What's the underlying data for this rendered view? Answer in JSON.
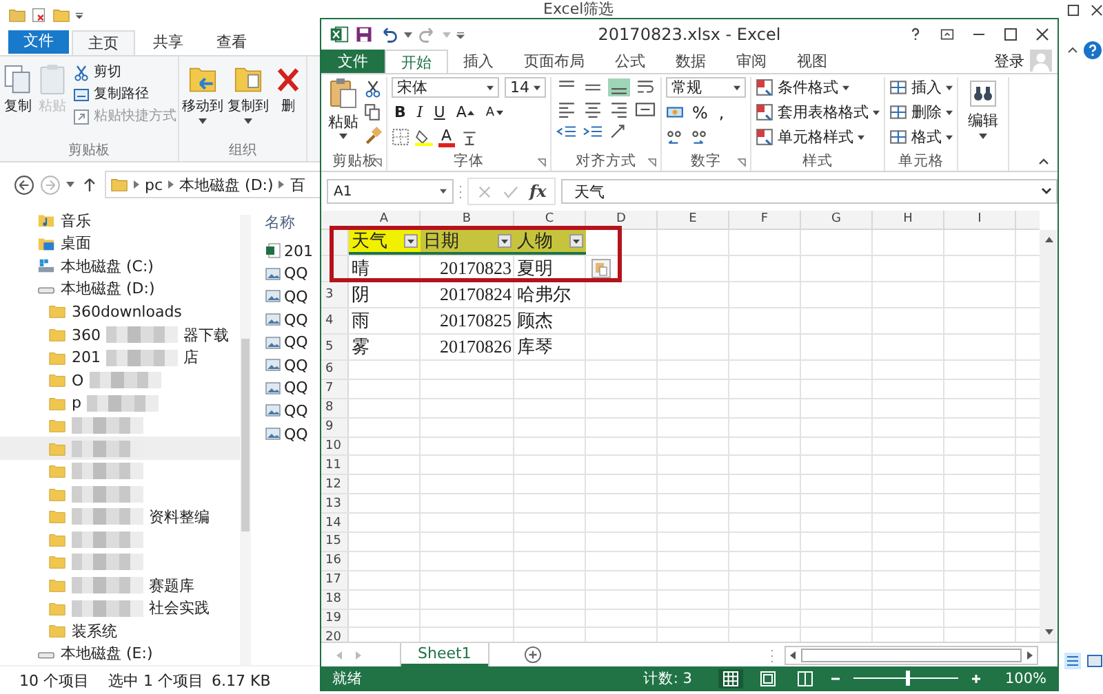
{
  "explorer": {
    "title": "Excel筛选",
    "tabs": [
      {
        "label": "文件",
        "kind": "file",
        "selected": false
      },
      {
        "label": "主页",
        "kind": "tab",
        "selected": true
      },
      {
        "label": "共享",
        "kind": "tab",
        "selected": false
      },
      {
        "label": "查看",
        "kind": "tab",
        "selected": false
      }
    ],
    "groups": [
      {
        "label": "剪贴板",
        "large": [
          {
            "label": "复制",
            "kind": "copy",
            "disabled": false,
            "dropdown": false
          },
          {
            "label": "粘贴",
            "kind": "paste",
            "disabled": true,
            "dropdown": false
          }
        ],
        "small": [
          {
            "label": "剪切",
            "kind": "cut",
            "disabled": false
          },
          {
            "label": "复制路径",
            "kind": "copy-path",
            "disabled": false
          },
          {
            "label": "粘贴快捷方式",
            "kind": "paste-shortcut",
            "disabled": true
          }
        ]
      },
      {
        "label": "组织",
        "large": [
          {
            "label": "移动到",
            "kind": "move",
            "disabled": false,
            "dropdown": true
          },
          {
            "label": "复制到",
            "kind": "copy-to",
            "disabled": false,
            "dropdown": true
          },
          {
            "label": "删",
            "kind": "delete",
            "disabled": false,
            "dropdown": false
          }
        ]
      }
    ],
    "crumbs": [
      "pc",
      "本地磁盘 (D:)",
      "百"
    ],
    "nav": [
      {
        "label": "音乐",
        "kind": "music"
      },
      {
        "label": "桌面",
        "kind": "desktop"
      },
      {
        "label": "本地磁盘 (C:)",
        "kind": "system-drive"
      },
      {
        "label": "本地磁盘 (D:)",
        "kind": "drive",
        "children": [
          {
            "prefix": "360downloads",
            "redacted": false,
            "selected": false
          },
          {
            "prefix": "360",
            "suffix": "器下载",
            "redacted": true,
            "selected": false
          },
          {
            "prefix": "201",
            "suffix": "店",
            "redacted": true,
            "selected": false
          },
          {
            "prefix": "O",
            "redacted": true,
            "selected": false
          },
          {
            "prefix": "p",
            "redacted": true,
            "selected": false
          },
          {
            "redacted": true,
            "selected": false
          },
          {
            "redacted": true,
            "selected": true
          },
          {
            "redacted": true,
            "selected": false
          },
          {
            "redacted": true,
            "selected": false
          },
          {
            "suffix": "资料整编",
            "redacted": true,
            "selected": false
          },
          {
            "redacted": true,
            "selected": false
          },
          {
            "redacted": true,
            "selected": false
          },
          {
            "suffix": "赛题库",
            "redacted": true,
            "selected": false
          },
          {
            "suffix": "社会实践",
            "redacted": true,
            "selected": false
          },
          {
            "prefix": "装系统",
            "redacted": false,
            "selected": false
          }
        ]
      },
      {
        "label": "本地磁盘 (E:)",
        "kind": "drive"
      }
    ],
    "column_header": "名称",
    "files": [
      {
        "name": "201",
        "kind": "excel"
      },
      {
        "name": "QQ",
        "kind": "image"
      },
      {
        "name": "QQ",
        "kind": "image"
      },
      {
        "name": "QQ",
        "kind": "image"
      },
      {
        "name": "QQ",
        "kind": "image"
      },
      {
        "name": "QQ",
        "kind": "image"
      },
      {
        "name": "QQ",
        "kind": "image"
      },
      {
        "name": "QQ",
        "kind": "image"
      },
      {
        "name": "QQ",
        "kind": "image"
      }
    ],
    "status": [
      "10 个项目",
      "选中 1 个项目",
      "6.17 KB"
    ]
  },
  "excel": {
    "title": "20170823.xlsx - Excel",
    "tabs": [
      {
        "label": "文件",
        "kind": "file",
        "selected": false
      },
      {
        "label": "开始",
        "kind": "tab",
        "selected": true
      },
      {
        "label": "插入",
        "kind": "tab",
        "selected": false
      },
      {
        "label": "页面布局",
        "kind": "tab",
        "selected": false
      },
      {
        "label": "公式",
        "kind": "tab",
        "selected": false
      },
      {
        "label": "数据",
        "kind": "tab",
        "selected": false
      },
      {
        "label": "审阅",
        "kind": "tab",
        "selected": false
      },
      {
        "label": "视图",
        "kind": "tab",
        "selected": false
      }
    ],
    "sign_in": "登录",
    "ribbon": {
      "clipboard": {
        "label": "剪贴板",
        "paste": "粘贴"
      },
      "font": {
        "label": "字体",
        "family": "宋体",
        "size": "14",
        "buttons": [
          {
            "label": "B",
            "kind": "bold"
          },
          {
            "label": "I",
            "kind": "italic"
          },
          {
            "label": "U",
            "kind": "underline"
          },
          {
            "label": "A",
            "kind": "grow"
          },
          {
            "label": "A",
            "kind": "shrink"
          }
        ],
        "color_button": "A"
      },
      "alignment": {
        "label": "对齐方式",
        "buttons": [
          {
            "kind": "top",
            "selected": false
          },
          {
            "kind": "middle",
            "selected": false
          },
          {
            "kind": "bottom",
            "selected": true
          },
          {
            "kind": "wrap",
            "selected": false
          },
          {
            "kind": "left",
            "selected": false
          },
          {
            "kind": "center",
            "selected": false
          },
          {
            "kind": "right",
            "selected": false
          },
          {
            "kind": "merge",
            "selected": false
          },
          {
            "kind": "outdent",
            "selected": false
          },
          {
            "kind": "indent",
            "selected": false
          },
          {
            "kind": "orient",
            "selected": false
          }
        ]
      },
      "number": {
        "label": "数字",
        "format": "常规",
        "symbols": [
          "%",
          ","
        ]
      },
      "styles": {
        "label": "样式",
        "items": [
          "条件格式",
          "套用表格格式",
          "单元格样式"
        ]
      },
      "cells": {
        "label": "单元格",
        "items": [
          "插入",
          "删除",
          "格式"
        ]
      },
      "editing": {
        "label": "编辑"
      }
    },
    "name_box": "A1",
    "function_button": "fx",
    "formula": "天气",
    "columns": [
      "A",
      "B",
      "C",
      "D",
      "E",
      "F",
      "G",
      "H",
      "I"
    ],
    "rows": [
      {
        "kind": "header",
        "cells": [
          {
            "text": "天气",
            "active": true
          },
          {
            "text": "日期",
            "active": false
          },
          {
            "text": "人物",
            "active": false
          }
        ]
      },
      {
        "kind": "data",
        "paste_options": true,
        "cells": [
          {
            "text": "晴",
            "kind": "text"
          },
          {
            "text": "20170823",
            "kind": "number"
          },
          {
            "text": "夏明",
            "kind": "text"
          }
        ]
      },
      {
        "number": "3",
        "kind": "data",
        "cells": [
          {
            "text": "阴",
            "kind": "text"
          },
          {
            "text": "20170824",
            "kind": "number"
          },
          {
            "text": "哈弗尔",
            "kind": "text"
          }
        ]
      },
      {
        "number": "4",
        "kind": "data",
        "cells": [
          {
            "text": "雨",
            "kind": "text"
          },
          {
            "text": "20170825",
            "kind": "number"
          },
          {
            "text": "顾杰",
            "kind": "text"
          }
        ]
      },
      {
        "number": "5",
        "kind": "data",
        "cells": [
          {
            "text": "雾",
            "kind": "text"
          },
          {
            "text": "20170826",
            "kind": "number"
          },
          {
            "text": "库琴",
            "kind": "text"
          }
        ]
      },
      {
        "number": "6",
        "kind": "empty"
      },
      {
        "number": "7",
        "kind": "empty"
      },
      {
        "number": "8",
        "kind": "empty"
      },
      {
        "number": "9",
        "kind": "empty"
      },
      {
        "number": "10",
        "kind": "empty"
      },
      {
        "number": "11",
        "kind": "empty"
      },
      {
        "number": "12",
        "kind": "empty"
      },
      {
        "number": "13",
        "kind": "empty"
      },
      {
        "number": "14",
        "kind": "empty"
      },
      {
        "number": "15",
        "kind": "empty"
      },
      {
        "number": "16",
        "kind": "empty"
      },
      {
        "number": "17",
        "kind": "empty"
      },
      {
        "number": "18",
        "kind": "empty"
      },
      {
        "number": "19",
        "kind": "empty"
      },
      {
        "number": "20",
        "kind": "empty"
      }
    ],
    "sheet_tabs": [
      {
        "label": "Sheet1",
        "selected": true
      }
    ],
    "status": {
      "ready": "就绪",
      "count": "计数: 3",
      "zoom": "100%",
      "level": 0.52,
      "views": [
        {
          "kind": "normal",
          "selected": true
        },
        {
          "kind": "layout",
          "selected": false
        },
        {
          "kind": "pagebreak",
          "selected": false
        }
      ]
    }
  }
}
